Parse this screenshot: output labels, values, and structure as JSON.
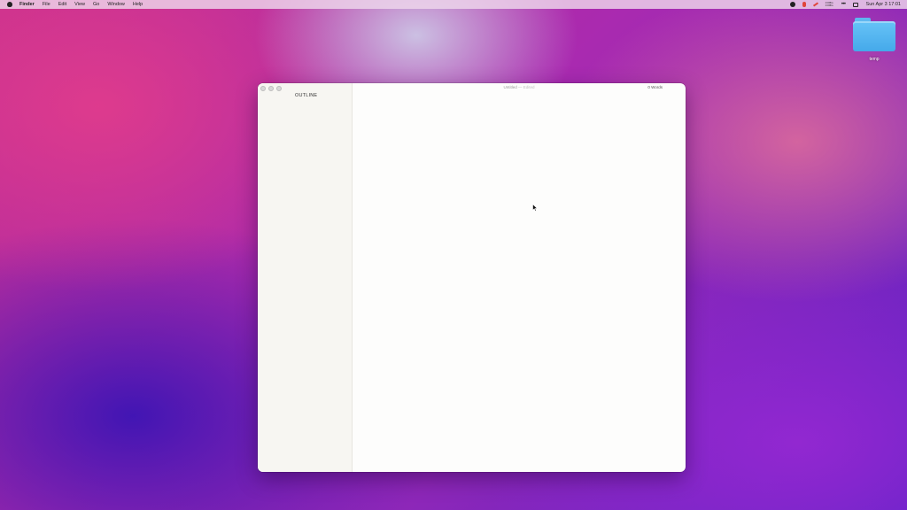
{
  "menubar": {
    "app_name": "Finder",
    "items": [
      "File",
      "Edit",
      "View",
      "Go",
      "Window",
      "Help"
    ],
    "net_up": "0 KB/s",
    "net_down": "0 KB/s",
    "clock": "Sun Apr 3  17:01"
  },
  "desktop": {
    "folder_label": "temp"
  },
  "window": {
    "sidebar_title": "OUTLINE",
    "doc_title": "Untitled",
    "doc_separator": "—",
    "doc_state": "Edited",
    "word_count": "0 Words"
  }
}
